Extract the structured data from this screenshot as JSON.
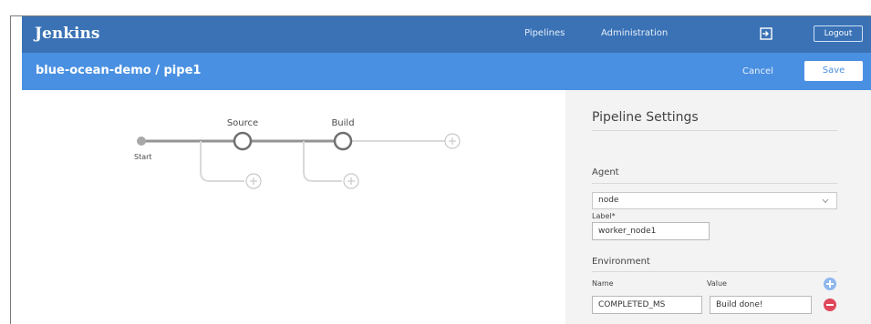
{
  "header": {
    "logo": "Jenkins",
    "nav": [
      "Pipelines",
      "Administration"
    ],
    "logout_label": "Logout",
    "exit_icon": "exit-icon"
  },
  "subheader": {
    "breadcrumb": "blue-ocean-demo / pipe1",
    "cancel_label": "Cancel",
    "save_label": "Save"
  },
  "pipeline": {
    "start_label": "Start",
    "stages": [
      "Source",
      "Build"
    ]
  },
  "settings": {
    "title": "Pipeline Settings",
    "agent_label": "Agent",
    "agent_value": "node",
    "label_label": "Label*",
    "label_value": "worker_node1",
    "environment_label": "Environment",
    "name_col": "Name",
    "value_col": "Value",
    "env_rows": [
      {
        "name": "COMPLETED_MS",
        "value": "Build done!"
      }
    ]
  },
  "colors": {
    "brand_dark": "#3a72b5",
    "brand": "#4a90e2",
    "remove": "#e0475a",
    "add": "#8fb7ee"
  }
}
